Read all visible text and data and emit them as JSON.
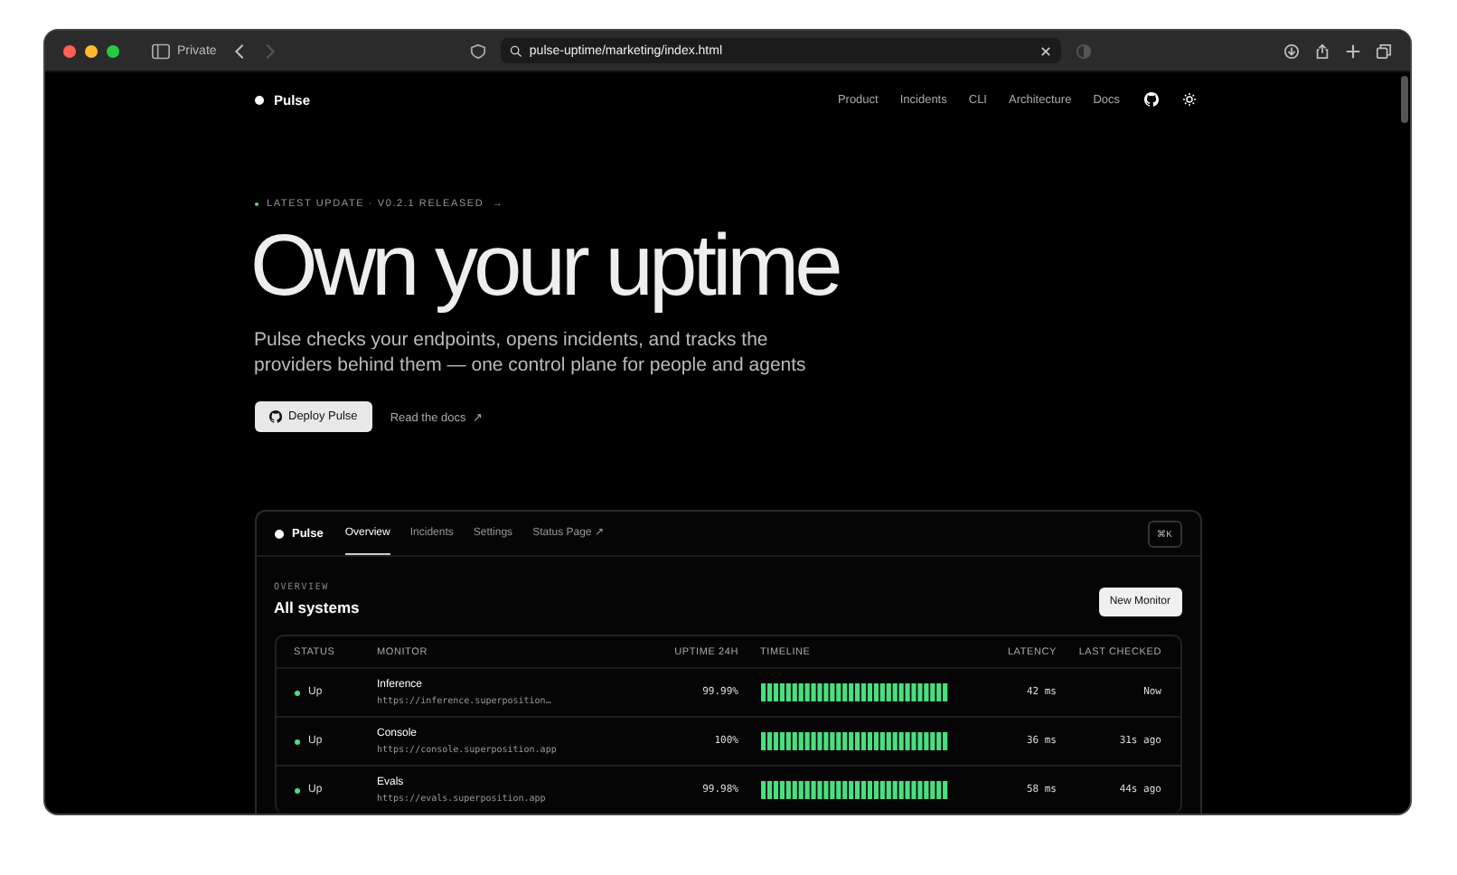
{
  "browser": {
    "private_label": "Private",
    "url": "pulse-uptime/marketing/index.html"
  },
  "nav": {
    "brand": "Pulse",
    "links": [
      "Product",
      "Incidents",
      "CLI",
      "Architecture",
      "Docs"
    ]
  },
  "hero": {
    "eyebrow": "LATEST UPDATE · V0.2.1 RELEASED",
    "eyebrow_arrow": "→",
    "title": "Own your uptime",
    "subtitle": "Pulse checks your endpoints, opens incidents, and tracks the providers behind them — one control plane for people and agents",
    "primary_button": "Deploy Pulse",
    "secondary_link": "Read the docs",
    "secondary_arrow": "↗"
  },
  "dashboard": {
    "brand": "Pulse",
    "tabs": [
      {
        "label": "Overview",
        "selected": true
      },
      {
        "label": "Incidents",
        "selected": false
      },
      {
        "label": "Settings",
        "selected": false
      },
      {
        "label": "Status Page ↗",
        "selected": false
      }
    ],
    "shortcut": "⌘K",
    "section_label": "OVERVIEW",
    "section_title": "All systems",
    "new_button": "New Monitor",
    "table": {
      "columns": [
        "STATUS",
        "MONITOR",
        "UPTIME 24H",
        "TIMELINE",
        "LATENCY",
        "LAST CHECKED"
      ],
      "rows": [
        {
          "status": "Up",
          "color": "#4ade80",
          "name": "Inference",
          "url": "https://inference.superposition…",
          "uptime": "99.99%",
          "latency": "42 ms",
          "last_checked": "Now"
        },
        {
          "status": "Up",
          "color": "#4ade80",
          "name": "Console",
          "url": "https://console.superposition.app",
          "uptime": "100%",
          "latency": "36 ms",
          "last_checked": "31s ago"
        },
        {
          "status": "Up",
          "color": "#4ade80",
          "name": "Evals",
          "url": "https://evals.superposition.app",
          "uptime": "99.98%",
          "latency": "58 ms",
          "last_checked": "44s ago"
        }
      ]
    }
  }
}
